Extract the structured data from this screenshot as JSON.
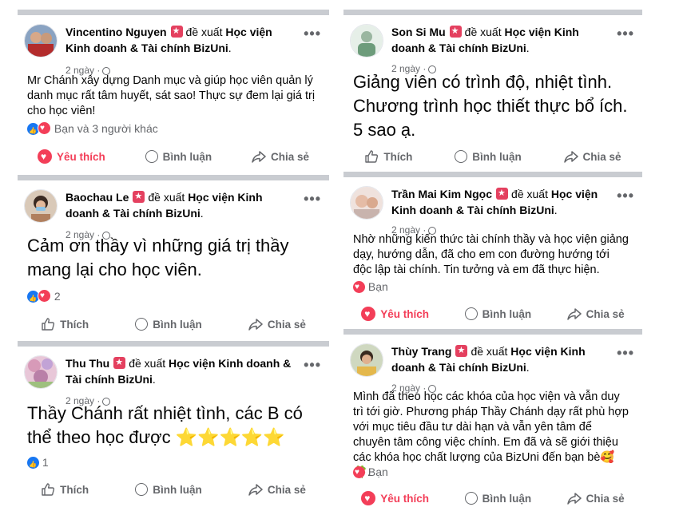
{
  "common": {
    "rec_text": "đề xuất",
    "page_name": "Học viện Kinh doanh & Tài chính BizUni",
    "period": ".",
    "time": "2 ngày",
    "dot": "·",
    "more": "•••",
    "like": "Thích",
    "loved": "Yêu thích",
    "comment": "Bình luận",
    "share": "Chia sẻ"
  },
  "posts": [
    {
      "author": "Vincentino Nguyen",
      "text": "Mr Chánh xây dựng Danh mục và giúp học viên quản lý danh mục rất tâm huyết, sát sao! Thực sự đem lại giá trị cho học viên!",
      "reactions": "Bạn và 3 người khác",
      "reaction_icons": [
        "like",
        "love"
      ],
      "reacted": "loved"
    },
    {
      "author": "Son Si Mu",
      "text": "Giảng viên có trình độ, nhiệt tình. Chương trình học thiết thực bổ ích. 5 sao ạ.",
      "reactions": "",
      "reaction_icons": [],
      "reacted": "none"
    },
    {
      "author": "Baochau Le",
      "text": "Cảm ơn thầy vì những giá trị thầy mang lại cho học viên.",
      "reactions": "2",
      "reaction_icons": [
        "like",
        "love"
      ],
      "reacted": "none"
    },
    {
      "author": "Trần Mai Kim Ngọc",
      "text": "Nhờ những kiến thức tài chính thầy và học viện giảng dạy, hướng dẫn, đã cho em con đường hướng tới độc lập tài chính. Tin tưởng và em đã thực hiện.",
      "reactions": "Bạn",
      "reaction_icons": [
        "love"
      ],
      "reacted": "loved"
    },
    {
      "author": "Thu Thu",
      "text": "Thầy Chánh rất nhiệt tình, các B có thể theo học được ⭐⭐⭐⭐⭐",
      "reactions": "1",
      "reaction_icons": [
        "like"
      ],
      "reacted": "none"
    },
    {
      "author": "Thùy Trang",
      "text": "Mình đã theo học các khóa của học viện và vẫn duy trì tới giờ. Phương pháp Thầy Chánh dạy rất phù hợp với mục tiêu đầu tư dài hạn và vẫn yên tâm để chuyên tâm công việc chính. Em đã và sẽ giới thiệu các khóa học chất lượng của BizUni đến bạn bè🥰🍀.",
      "reactions": "Bạn",
      "reaction_icons": [
        "love"
      ],
      "reacted": "loved"
    }
  ],
  "colors": {
    "love": "#f33e58",
    "like": "#1877f2",
    "muted": "#65676b",
    "divider": "#c9ccd1",
    "badge": "#e4405f"
  }
}
